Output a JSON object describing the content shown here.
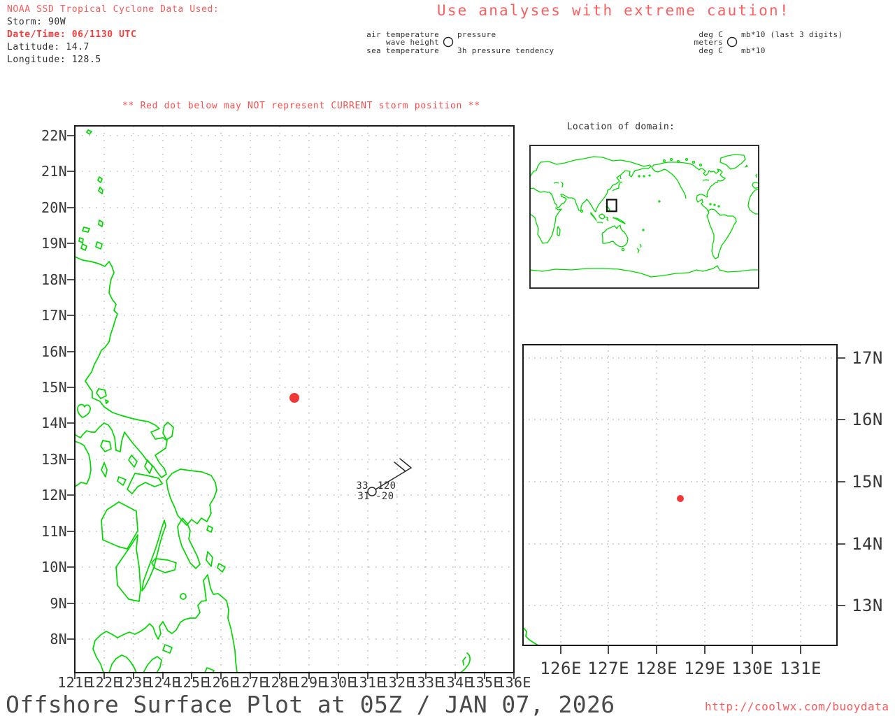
{
  "header": {
    "noaa_line": "NOAA SSD Tropical Cyclone Data Used:",
    "storm_line": "Storm: 90W",
    "datetime_line": "Date/Time: 06/1130 UTC",
    "latitude_line": "Latitude: 14.7",
    "longitude_line": "Longitude: 128.5",
    "warning": "Use analyses with extreme caution!"
  },
  "station_legend": {
    "air_temp_label": "air temperature",
    "wave_height_label": "wave height",
    "sea_temp_label": "sea temperature",
    "pressure_label": "pressure",
    "tendency_label": "3h pressure tendency",
    "air_temp_units": "deg C",
    "wave_height_units": "meters",
    "sea_temp_units": "deg C",
    "pressure_units": "mb*10 (last 3 digits)",
    "tendency_units": "mb*10"
  },
  "main_map": {
    "note": "** Red dot below may NOT represent CURRENT storm position **",
    "x_tick_labels": [
      "121E",
      "122E",
      "123E",
      "124E",
      "125E",
      "126E",
      "127E",
      "128E",
      "129E",
      "130E",
      "131E",
      "132E",
      "133E",
      "134E",
      "135E",
      "136E"
    ],
    "y_tick_labels": [
      "22N",
      "21N",
      "20N",
      "19N",
      "18N",
      "17N",
      "16N",
      "15N",
      "14N",
      "13N",
      "12N",
      "11N",
      "10N",
      "9N",
      "8N"
    ],
    "storm_dot": {
      "lat": 14.7,
      "lon": 128.5
    },
    "station_plot": {
      "air_temp": "33",
      "sea_temp": "31",
      "pressure": "120",
      "pressure_tendency": "-20"
    }
  },
  "world_inset": {
    "title": "Location of domain:"
  },
  "zoom_map": {
    "x_tick_labels": [
      "126E",
      "127E",
      "128E",
      "129E",
      "130E",
      "131E"
    ],
    "y_tick_labels": [
      "17N",
      "16N",
      "15N",
      "14N",
      "13N"
    ],
    "storm_dot": {
      "lat": 14.7,
      "lon": 128.5
    }
  },
  "footer": {
    "title": "Offshore Surface Plot at 05Z / JAN 07, 2026",
    "url": "http://coolwx.com/buoydata"
  },
  "colors": {
    "coastline_green": "#00d800",
    "storm_red": "#f23737",
    "text_red": "#fa5a5a",
    "alert_red": "#f83c3c"
  }
}
